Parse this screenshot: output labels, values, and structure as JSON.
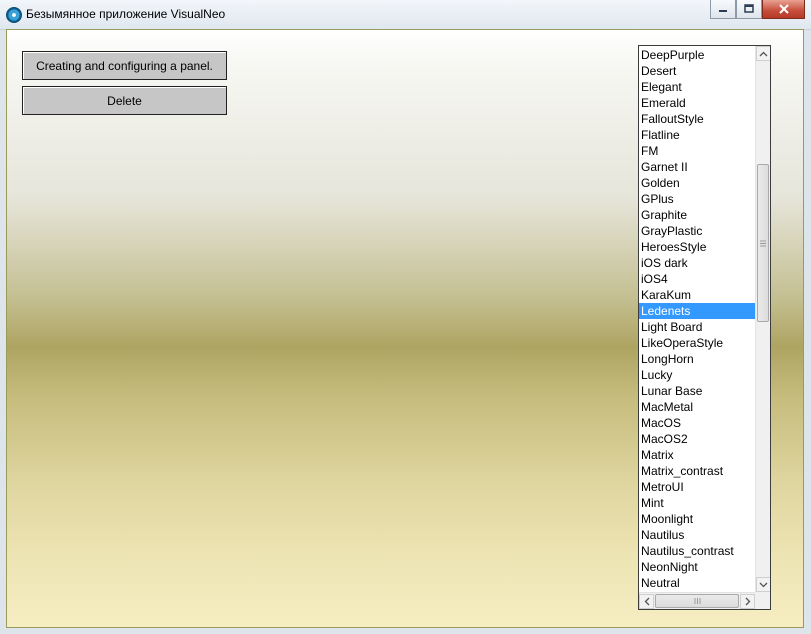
{
  "window": {
    "title": "Безымянное приложение VisualNeo"
  },
  "buttons": {
    "panel_label": "Creating and configuring a panel.",
    "delete_label": "Delete"
  },
  "listbox": {
    "selected_index": 16,
    "items": [
      "DeepPurple",
      "Desert",
      "Elegant",
      "Emerald",
      "FalloutStyle",
      "Flatline",
      "FM",
      "Garnet II",
      "Golden",
      "GPlus",
      "Graphite",
      "GrayPlastic",
      "HeroesStyle",
      "iOS dark",
      "iOS4",
      "KaraKum",
      "Ledenets",
      "Light Board",
      "LikeOperaStyle",
      "LongHorn",
      "Lucky",
      "Lunar Base",
      "MacMetal",
      "MacOS",
      "MacOS2",
      "Matrix",
      "Matrix_contrast",
      "MetroUI",
      "Mint",
      "Moonlight",
      "Nautilus",
      "Nautilus_contrast",
      "NeonNight",
      "Neutral"
    ]
  },
  "colors": {
    "selection": "#3399ff",
    "close_button": "#c64d3a"
  }
}
